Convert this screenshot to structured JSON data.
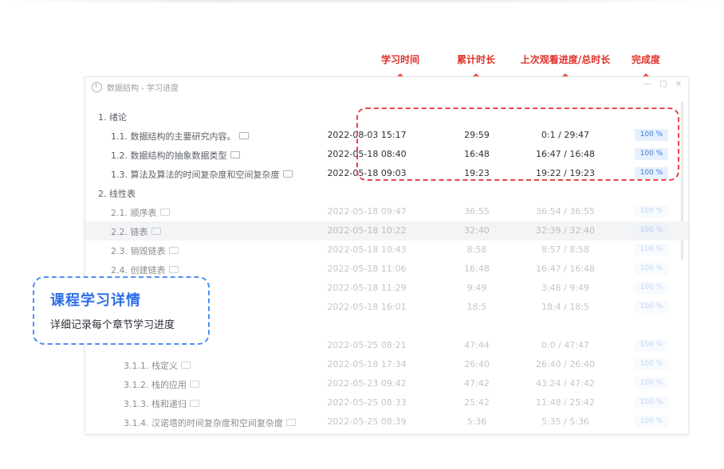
{
  "annotations": {
    "study_time": "学习时间",
    "total_duration": "累计时长",
    "last_progress": "上次观看进度/总时长",
    "completion": "完成度",
    "arrow_color": "#e0302a"
  },
  "window": {
    "title": "数据结构 - 学习进度",
    "controls": [
      "—",
      "□",
      "×"
    ]
  },
  "rows": [
    {
      "name": "1.  绪论",
      "has_tag": false,
      "time": "",
      "total": "",
      "progress": "",
      "pct": ""
    },
    {
      "name": "1.1.  数据结构的主要研究内容。",
      "has_tag": true,
      "time": "2022-08-03 15:17",
      "total": "29:59",
      "progress": "0:1 / 29:47",
      "pct": "100 %"
    },
    {
      "name": "1.2.  数据结构的抽象数据类型",
      "has_tag": true,
      "time": "2022-05-18 08:40",
      "total": "16:48",
      "progress": "16:47 / 16:48",
      "pct": "100 %"
    },
    {
      "name": "1.3.  算法及算法的时间复杂度和空间复杂度",
      "has_tag": true,
      "time": "2022-05-18 09:03",
      "total": "19:23",
      "progress": "19:22 / 19:23",
      "pct": "100 %"
    },
    {
      "name": "2.  线性表",
      "has_tag": false,
      "time": "",
      "total": "",
      "progress": "",
      "pct": ""
    },
    {
      "name": "2.1.  顺序表",
      "has_tag": true,
      "time": "2022-05-18 09:47",
      "total": "36:55",
      "progress": "36:54 / 36:55",
      "pct": "100 %"
    },
    {
      "name": "2.2.  链表",
      "has_tag": true,
      "time": "2022-05-18 10:22",
      "total": "32:40",
      "progress": "32:39 / 32:40",
      "pct": "100 %"
    },
    {
      "name": "2.3.  销毁链表",
      "has_tag": true,
      "time": "2022-05-18 10:43",
      "total": "8:58",
      "progress": "8:57 / 8:58",
      "pct": "100 %"
    },
    {
      "name": "2.4.  创建链表",
      "has_tag": true,
      "time": "2022-05-18 11:06",
      "total": "16:48",
      "progress": "16:47 / 16:48",
      "pct": "100 %"
    },
    {
      "name": "",
      "has_tag": false,
      "time": "2022-05-18 11:29",
      "total": "9:49",
      "progress": "3:48 / 9:49",
      "pct": "100 %"
    },
    {
      "name": "",
      "has_tag": false,
      "time": "2022-05-18 16:01",
      "total": "18:5",
      "progress": "18:4 / 18:5",
      "pct": "100 %"
    },
    {
      "name": "",
      "has_tag": false,
      "time": "",
      "total": "",
      "progress": "",
      "pct": ""
    },
    {
      "name": "",
      "has_tag": false,
      "time": "2022-05-25 08:21",
      "total": "47:44",
      "progress": "0:0 / 47:47",
      "pct": "100 %"
    },
    {
      "name": "3.1.1.  栈定义",
      "has_tag": true,
      "time": "2022-05-18 17:34",
      "total": "26:40",
      "progress": "26:40 / 26:40",
      "pct": "100 %"
    },
    {
      "name": "3.1.2.  栈的应用",
      "has_tag": true,
      "time": "2022-05-23 09:42",
      "total": "47:42",
      "progress": "43:24 / 47:42",
      "pct": "100 %"
    },
    {
      "name": "3.1.3.  栈和递归",
      "has_tag": true,
      "time": "2022-05-25 08:33",
      "total": "25:42",
      "progress": "11:48 / 25:42",
      "pct": "100 %"
    },
    {
      "name": "3.1.4.  汉诺塔的时间复杂度和空间复杂度",
      "has_tag": true,
      "time": "2022-05-25 08:39",
      "total": "5:36",
      "progress": "5:35 / 5:36",
      "pct": "100 %"
    }
  ],
  "callout": {
    "heading": "课程学习详情",
    "subtext": "详细记录每个章节学习进度"
  }
}
